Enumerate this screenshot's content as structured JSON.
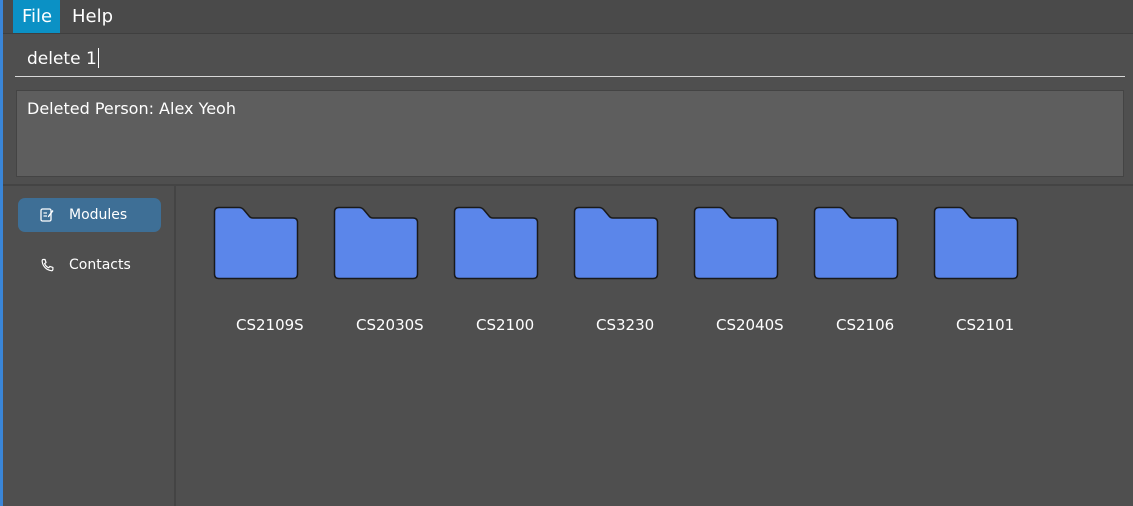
{
  "menu": {
    "file_label": "File",
    "help_label": "Help"
  },
  "command": {
    "value": "delete 1"
  },
  "result": {
    "text": "Deleted Person: Alex Yeoh"
  },
  "sidebar": {
    "items": [
      {
        "label": "Modules",
        "icon": "edit-note-icon",
        "selected": true
      },
      {
        "label": "Contacts",
        "icon": "phone-icon",
        "selected": false
      }
    ]
  },
  "modules": [
    {
      "code": "CS2109S"
    },
    {
      "code": "CS2030S"
    },
    {
      "code": "CS2100"
    },
    {
      "code": "CS3230"
    },
    {
      "code": "CS2040S"
    },
    {
      "code": "CS2106"
    },
    {
      "code": "CS2101"
    }
  ],
  "colors": {
    "background": "#4f4f4f",
    "menu_active": "#0b91c5",
    "nav_selected": "#3e6f96",
    "folder_fill": "#5b86ea",
    "accent": "#3a86d8"
  }
}
